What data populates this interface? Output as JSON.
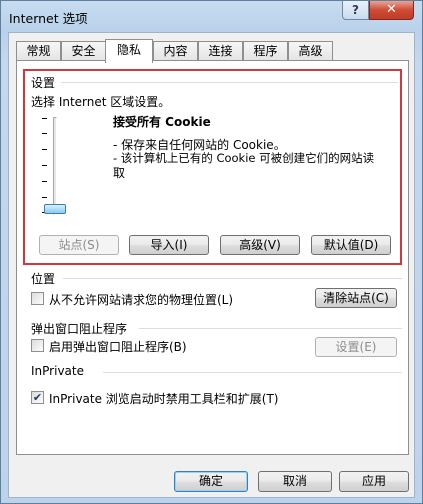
{
  "window": {
    "title": "Internet 选项",
    "help_label": "?",
    "close_label": "✕"
  },
  "tabs": [
    {
      "label": "常规",
      "active": false
    },
    {
      "label": "安全",
      "active": false
    },
    {
      "label": "隐私",
      "active": true
    },
    {
      "label": "内容",
      "active": false
    },
    {
      "label": "连接",
      "active": false
    },
    {
      "label": "程序",
      "active": false
    },
    {
      "label": "高级",
      "active": false
    }
  ],
  "settings": {
    "group_label": "设置",
    "instruction": "选择 Internet 区域设置。",
    "level_title": "接受所有 Cookie",
    "desc_lines": [
      "- 保存来自任何网站的 Cookie。",
      "- 该计算机上已有的 Cookie 可被创建它们的网站读",
      "取"
    ],
    "slider_level": 0,
    "buttons": {
      "sites": "站点(S)",
      "import": "导入(I)",
      "advanced": "高级(V)",
      "default": "默认值(D)"
    }
  },
  "location": {
    "group_label": "位置",
    "checkbox_label": "从不允许网站请求您的物理位置(L)",
    "checked": false,
    "clear_button": "清除站点(C)"
  },
  "popup": {
    "group_label": "弹出窗口阻止程序",
    "checkbox_label": "启用弹出窗口阻止程序(B)",
    "checked": false,
    "settings_button": "设置(E)"
  },
  "inprivate": {
    "group_label": "InPrivate",
    "checkbox_label": "InPrivate 浏览启动时禁用工具栏和扩展(T)",
    "checked": true
  },
  "footer": {
    "ok": "确定",
    "cancel": "取消",
    "apply": "应用"
  },
  "colors": {
    "highlight_border": "#d0383d",
    "thumb": "#8ccbef"
  }
}
